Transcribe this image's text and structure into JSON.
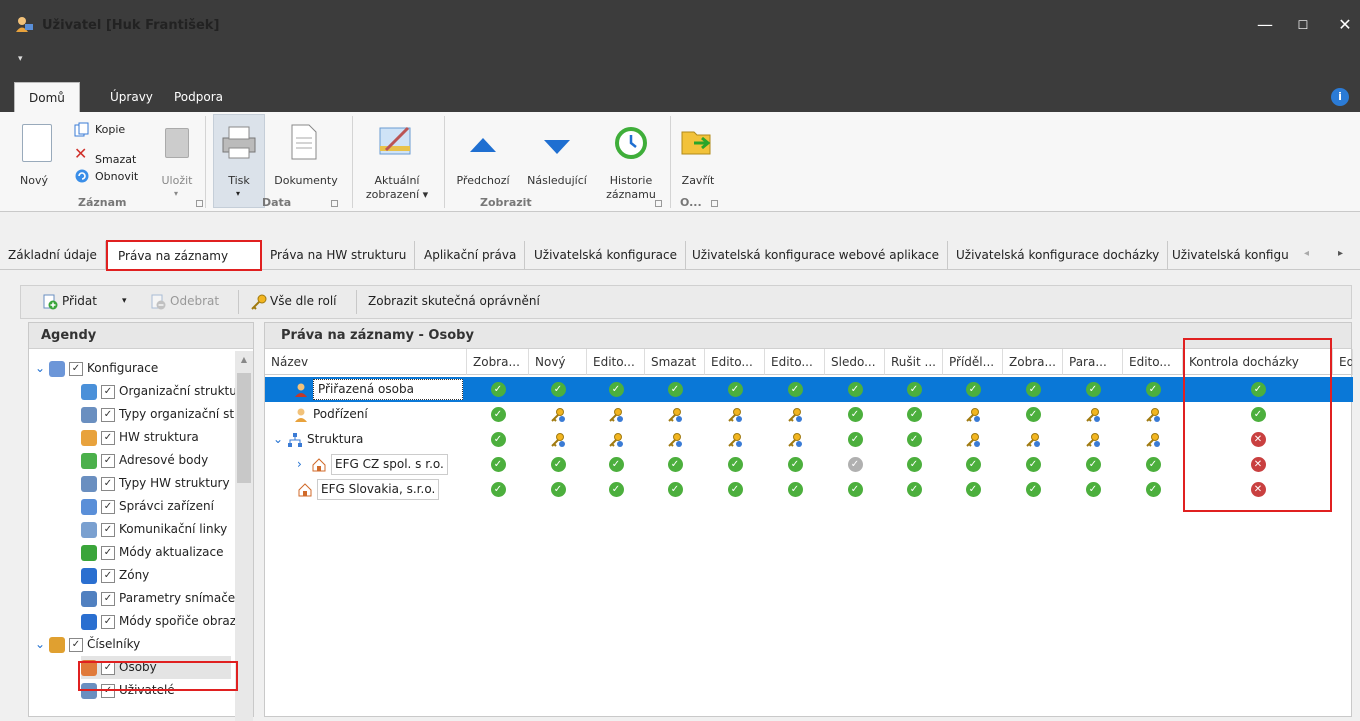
{
  "window": {
    "title": "Uživatel [Huk František]",
    "quick_access": "▾",
    "min": "—",
    "max": "☐",
    "close": "✕"
  },
  "ribbon_tabs": [
    {
      "label": "Domů",
      "active": true
    },
    {
      "label": "Úpravy"
    },
    {
      "label": "Podpora"
    }
  ],
  "info_icon": "i",
  "ribbon": {
    "new": "Nový",
    "copy": "Kopie",
    "delete": "Smazat",
    "refresh": "Obnovit",
    "save": "Uložit",
    "print": "Tisk",
    "documents": "Dokumenty",
    "current_view_1": "Aktuální",
    "current_view_2": "zobrazení ▾",
    "prev": "Předchozí",
    "next": "Následující",
    "history_1": "Historie",
    "history_2": "záznamu",
    "close": "Zavřít",
    "group_record": "Záznam",
    "group_data": "Data",
    "group_view": "Zobrazit",
    "group_o": "O..."
  },
  "doc_tabs": [
    "Základní údaje",
    "Práva na záznamy",
    "Práva na HW strukturu",
    "Aplikační práva",
    "Uživatelská konfigurace",
    "Uživatelská konfigurace webové aplikace",
    "Uživatelská konfigurace docházky",
    "Uživatelská konfigu"
  ],
  "toolbar": {
    "add": "Přidat",
    "add_dd": "▾",
    "remove": "Odebrat",
    "all_by_roles": "Vše dle rolí",
    "show_real": "Zobrazit skutečná oprávnění"
  },
  "left_panel": {
    "title": "Agendy",
    "items": [
      {
        "label": "Konfigurace",
        "expander": "⌄",
        "level": 0
      },
      {
        "label": "Organizační struktu",
        "level": 1
      },
      {
        "label": "Typy organizační st",
        "level": 1
      },
      {
        "label": "HW struktura",
        "level": 1
      },
      {
        "label": "Adresové body",
        "level": 1
      },
      {
        "label": "Typy HW struktury",
        "level": 1
      },
      {
        "label": "Správci zařízení",
        "level": 1
      },
      {
        "label": "Komunikační linky",
        "level": 1
      },
      {
        "label": "Módy aktualizace",
        "level": 1
      },
      {
        "label": "Zóny",
        "level": 1
      },
      {
        "label": "Parametry snímače",
        "level": 1
      },
      {
        "label": "Módy spořiče obraz",
        "level": 1
      },
      {
        "label": "Číselníky",
        "expander": "⌄",
        "level": 0
      },
      {
        "label": "Osoby",
        "level": 1,
        "highlight": true
      },
      {
        "label": "Uživatelé",
        "level": 1
      }
    ]
  },
  "right_panel": {
    "title": "Práva na záznamy - Osoby",
    "columns": [
      "Název",
      "Zobra...",
      "Nový",
      "Edito...",
      "Smazat",
      "Edito...",
      "Edito...",
      "Sledo...",
      "Rušit ...",
      "Příděl...",
      "Zobra...",
      "Para...",
      "Edito...",
      "Kontrola docházky",
      "Ed"
    ],
    "rows": [
      {
        "name": "Přiřazená osoba",
        "expander": "",
        "cells": [
          "ok",
          "ok",
          "ok",
          "ok",
          "ok",
          "ok",
          "ok",
          "ok",
          "ok",
          "ok",
          "ok",
          "ok",
          "ok"
        ]
      },
      {
        "name": "Podřízení",
        "expander": "",
        "cells": [
          "ok",
          "key",
          "key",
          "key",
          "key",
          "key",
          "ok",
          "ok",
          "key",
          "ok",
          "key",
          "key",
          "ok"
        ]
      },
      {
        "name": "Struktura",
        "expander": "⌄",
        "cells": [
          "ok",
          "key",
          "key",
          "key",
          "key",
          "key",
          "ok",
          "ok",
          "key",
          "key",
          "key",
          "key",
          "no"
        ]
      },
      {
        "name": "EFG CZ spol. s r.o.",
        "expander": "›",
        "cells": [
          "ok",
          "ok",
          "ok",
          "ok",
          "ok",
          "ok",
          "gray",
          "ok",
          "ok",
          "ok",
          "ok",
          "ok",
          "no"
        ]
      },
      {
        "name": "EFG Slovakia, s.r.o.",
        "expander": "",
        "cells": [
          "ok",
          "ok",
          "ok",
          "ok",
          "ok",
          "ok",
          "ok",
          "ok",
          "ok",
          "ok",
          "ok",
          "ok",
          "no"
        ]
      }
    ]
  },
  "symbols": {
    "check": "✓",
    "cross": "✕",
    "scroll_left": "◂",
    "scroll_right": "▸",
    "scroll_up": "▲"
  },
  "colors": {
    "titlebar": "#3c3c3c",
    "selected_row": "#0a78d7",
    "highlight_box": "#e02020",
    "ok": "#4caf3d",
    "no": "#c94040"
  }
}
